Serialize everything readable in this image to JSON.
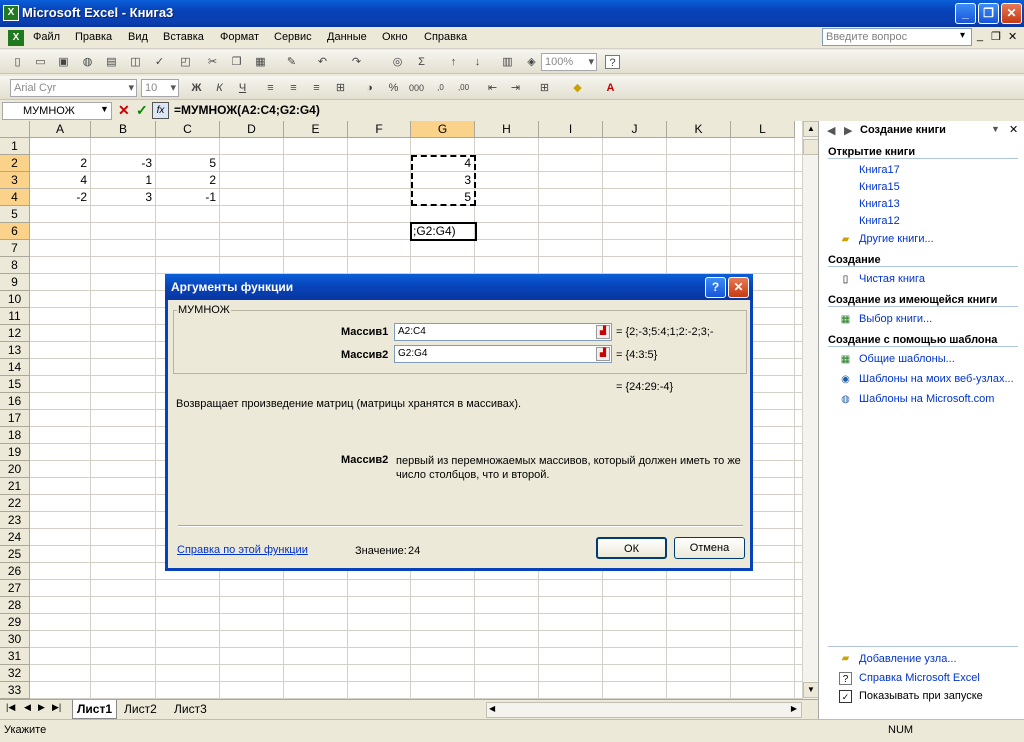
{
  "window": {
    "title": "Microsoft Excel - Книга3",
    "icon_label": "X"
  },
  "menu": {
    "items": [
      "Файл",
      "Правка",
      "Вид",
      "Вставка",
      "Формат",
      "Сервис",
      "Данные",
      "Окно",
      "Справка"
    ],
    "ask_placeholder": "Введите вопрос"
  },
  "toolbar": {
    "zoom": "100%",
    "font": "Arial Cyr",
    "size": "10"
  },
  "formula_bar": {
    "name_box": "МУМНОЖ",
    "fx": "fx",
    "formula": "=МУМНОЖ(A2:C4;G2:G4)"
  },
  "grid": {
    "columns": [
      "A",
      "B",
      "C",
      "D",
      "E",
      "F",
      "G",
      "H",
      "I",
      "J",
      "K",
      "L"
    ],
    "rows": [
      "1",
      "2",
      "3",
      "4",
      "5",
      "6",
      "7",
      "8",
      "9",
      "10",
      "11",
      "12",
      "13",
      "14",
      "15",
      "16",
      "17",
      "18",
      "19",
      "20",
      "21",
      "22",
      "23",
      "24",
      "25",
      "26",
      "27",
      "28",
      "29",
      "30",
      "31",
      "32",
      "33"
    ],
    "cells": {
      "A2": "2",
      "B2": "-3",
      "C2": "5",
      "A3": "4",
      "B3": "1",
      "C3": "2",
      "A4": "-2",
      "B4": "3",
      "C4": "-1",
      "G2": "4",
      "G3": "3",
      "G4": "5",
      "G6": ";G2:G4)"
    }
  },
  "sheets": [
    "Лист1",
    "Лист2",
    "Лист3"
  ],
  "status": {
    "left": "Укажите",
    "num": "NUM"
  },
  "taskpane": {
    "title": "Создание книги",
    "open_header": "Открытие книги",
    "recent": [
      "Книга17",
      "Книга15",
      "Книга13",
      "Книга12"
    ],
    "other_books": "Другие книги...",
    "create_header": "Создание",
    "blank": "Чистая книга",
    "from_existing_header": "Создание из имеющейся книги",
    "choose_book": "Выбор книги...",
    "template_header": "Создание с помощью шаблона",
    "templates": [
      "Общие шаблоны...",
      "Шаблоны на моих веб-узлах...",
      "Шаблоны на Microsoft.com"
    ],
    "add_node": "Добавление узла...",
    "help": "Справка Microsoft Excel",
    "show_on_start": "Показывать при запуске"
  },
  "dialog": {
    "title": "Аргументы функции",
    "group": "МУМНОЖ",
    "arg1_label": "Массив1",
    "arg1_value": "A2:C4",
    "arg1_result": "= {2;-3;5:4;1;2:-2;3;-",
    "arg2_label": "Массив2",
    "arg2_value": "G2:G4",
    "arg2_result": "= {4:3:5}",
    "result": "= {24:29:-4}",
    "description": "Возвращает произведение матриц (матрицы хранятся в массивах).",
    "arg_help_label": "Массив2",
    "arg_help_text": "первый из перемножаемых массивов, который должен иметь то же число столбцов, что и второй.",
    "help_link": "Справка по этой функции",
    "value_label": "Значение:",
    "value": "24",
    "ok": "ОК",
    "cancel": "Отмена"
  }
}
